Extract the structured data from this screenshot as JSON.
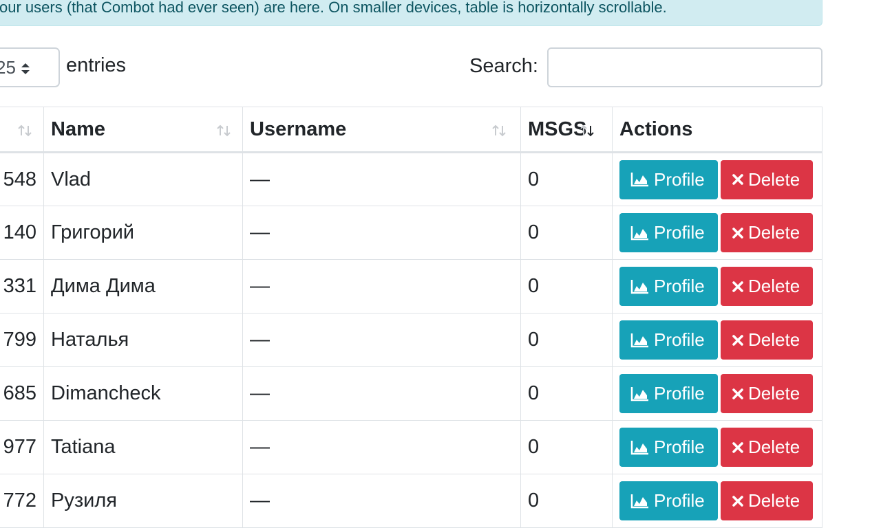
{
  "alert": {
    "text": "our users (that Combot had ever seen) are here. On smaller devices, table is horizontally scrollable."
  },
  "length": {
    "value": "25",
    "suffix": "entries"
  },
  "search": {
    "label": "Search:",
    "value": "",
    "placeholder": ""
  },
  "table": {
    "columns": [
      "",
      "Name",
      "Username",
      "MSGS",
      "Actions"
    ],
    "rows": [
      {
        "id": "548",
        "name": "Vlad",
        "username": "—",
        "msgs": "0"
      },
      {
        "id": "140",
        "name": "Григорий",
        "username": "—",
        "msgs": "0"
      },
      {
        "id": "331",
        "name": "Дима Дима",
        "username": "—",
        "msgs": "0"
      },
      {
        "id": "799",
        "name": "Наталья",
        "username": "—",
        "msgs": "0"
      },
      {
        "id": "685",
        "name": "Dimancheck",
        "username": "—",
        "msgs": "0"
      },
      {
        "id": "977",
        "name": "Tatiana",
        "username": "—",
        "msgs": "0"
      },
      {
        "id": "772",
        "name": "Рузиля",
        "username": "—",
        "msgs": "0"
      }
    ]
  },
  "actions": {
    "profile_label": "Profile",
    "delete_label": "Delete"
  },
  "icons": {
    "profile": "area-chart-icon",
    "delete": "close-icon",
    "sort": "sort-arrows-icon"
  },
  "colors": {
    "info": "#17a2b8",
    "danger": "#dc3545",
    "alert_bg": "#d1ecf1",
    "alert_text": "#0c5460"
  }
}
